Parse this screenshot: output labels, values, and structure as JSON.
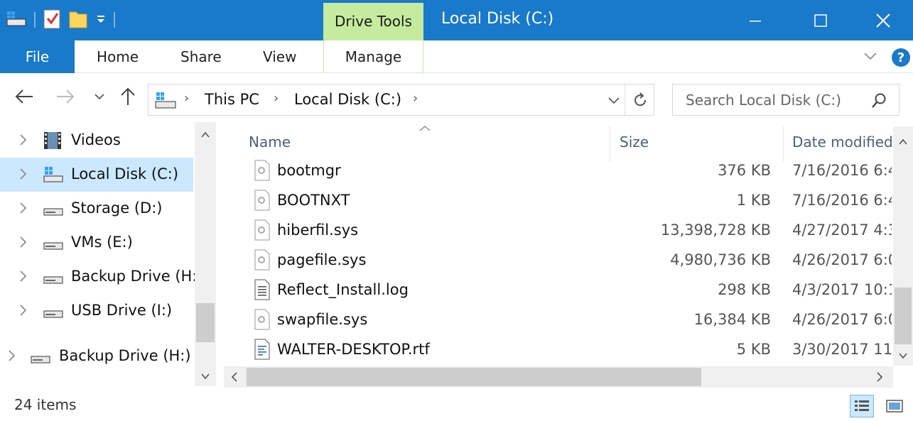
{
  "window": {
    "title": "Local Disk (C:)",
    "contextual_tab_group": "Drive Tools"
  },
  "ribbon": {
    "tabs": [
      "File",
      "Home",
      "Share",
      "View",
      "Manage"
    ],
    "help_label": "?"
  },
  "address": {
    "breadcrumbs": [
      "This PC",
      "Local Disk (C:)"
    ],
    "search_placeholder": "Search Local Disk (C:)"
  },
  "nav_pane": {
    "items": [
      {
        "label": "Videos",
        "icon": "videos-icon",
        "selected": false
      },
      {
        "label": "Local Disk (C:)",
        "icon": "windows-drive-icon",
        "selected": true
      },
      {
        "label": "Storage (D:)",
        "icon": "drive-icon",
        "selected": false
      },
      {
        "label": "VMs (E:)",
        "icon": "drive-icon",
        "selected": false
      },
      {
        "label": "Backup Drive (H:",
        "icon": "drive-icon",
        "selected": false
      },
      {
        "label": "USB Drive (I:)",
        "icon": "drive-icon",
        "selected": false
      }
    ],
    "extra_item": {
      "label": "Backup Drive (H:)",
      "icon": "drive-icon"
    }
  },
  "file_list": {
    "columns": {
      "name": "Name",
      "size": "Size",
      "date": "Date modified"
    },
    "rows": [
      {
        "name": "bootmgr",
        "size": "376 KB",
        "date": "7/16/2016 6:4",
        "icon": "system-file-icon"
      },
      {
        "name": "BOOTNXT",
        "size": "1 KB",
        "date": "7/16/2016 6:4",
        "icon": "system-file-icon"
      },
      {
        "name": "hiberfil.sys",
        "size": "13,398,728 KB",
        "date": "4/27/2017 4:3",
        "icon": "system-file-icon"
      },
      {
        "name": "pagefile.sys",
        "size": "4,980,736 KB",
        "date": "4/26/2017 6:0",
        "icon": "system-file-icon"
      },
      {
        "name": "Reflect_Install.log",
        "size": "298 KB",
        "date": "4/3/2017 10:1",
        "icon": "text-file-icon"
      },
      {
        "name": "swapfile.sys",
        "size": "16,384 KB",
        "date": "4/26/2017 6:0",
        "icon": "system-file-icon"
      },
      {
        "name": "WALTER-DESKTOP.rtf",
        "size": "5 KB",
        "date": "3/30/2017 11:",
        "icon": "rtf-file-icon"
      }
    ]
  },
  "status": {
    "item_count": "24 items"
  },
  "colors": {
    "accent": "#1979ca",
    "drive_tools": "#c4eb9e",
    "selection": "#cce8ff"
  }
}
